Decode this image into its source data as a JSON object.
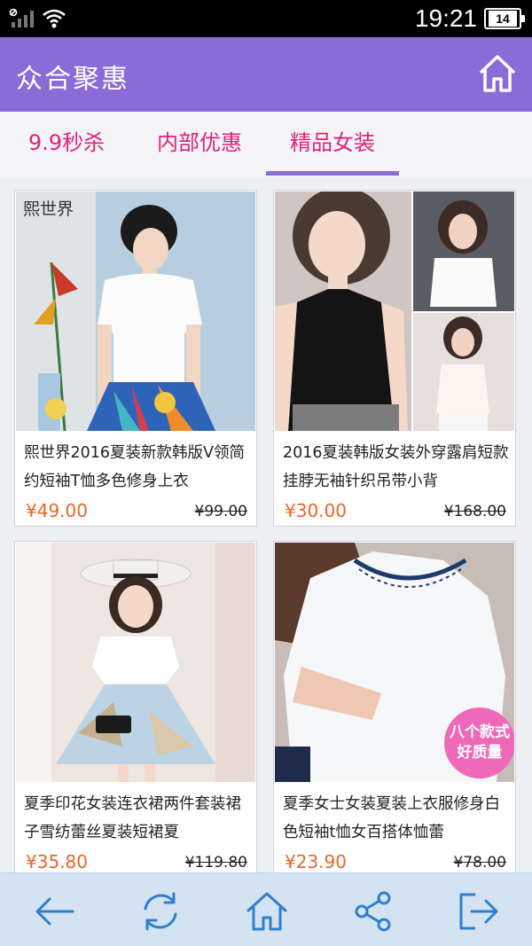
{
  "status": {
    "time": "19:21",
    "battery": "14"
  },
  "header": {
    "title": "众合聚惠"
  },
  "tabs": [
    {
      "label": "9.9秒杀"
    },
    {
      "label": "内部优惠"
    },
    {
      "label": "精品女装"
    }
  ],
  "products": [
    {
      "name": "熙世界2016夏装新款韩版V领简约短袖T恤多色修身上衣",
      "price": "¥49.00",
      "old_price": "¥99.00"
    },
    {
      "name": "2016夏装韩版女装外穿露肩短款挂脖无袖针织吊带小背",
      "price": "¥30.00",
      "old_price": "¥168.00"
    },
    {
      "name": "夏季印花女装连衣裙两件套装裙子雪纺蕾丝夏装短裙夏",
      "price": "¥35.80",
      "old_price": "¥119.80"
    },
    {
      "name": "夏季女士女装夏装上衣服修身白色短袖t恤女百搭体恤蕾",
      "price": "¥23.90",
      "old_price": "¥78.00"
    }
  ],
  "image_texts": {
    "brand_logo": "熙世界",
    "badge_line1": "八个款式",
    "badge_line2": "好质量"
  },
  "colors": {
    "accent": "#8a6bd8",
    "tab_text": "#e3217a",
    "price": "#e8662a",
    "toolbar_icon": "#2f7fd0"
  }
}
